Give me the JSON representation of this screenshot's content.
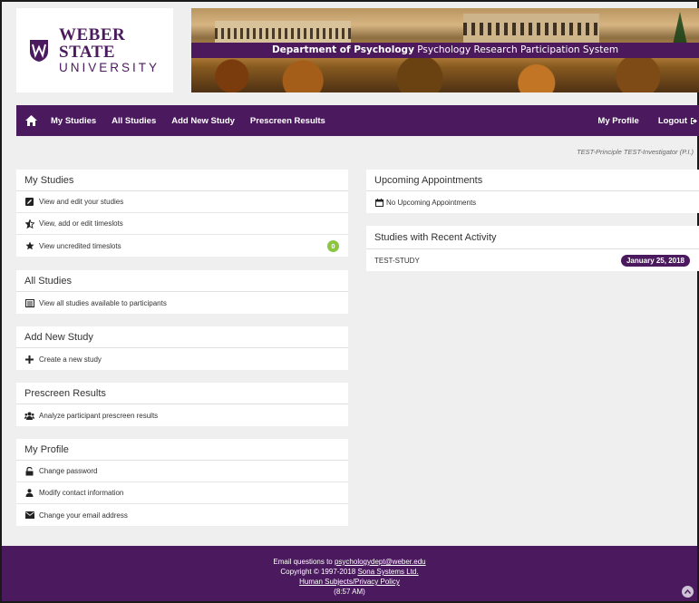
{
  "logo": {
    "line1": "WEBER STATE",
    "line2": "UNIVERSITY"
  },
  "banner": {
    "dept": "Department of Psychology",
    "system": " Psychology Research Participation System"
  },
  "nav": {
    "items": [
      "My Studies",
      "All Studies",
      "Add New Study",
      "Prescreen Results"
    ],
    "profile": "My Profile",
    "logout": "Logout"
  },
  "user_line": "TEST-Principle TEST-Investigator (P.I.)",
  "my_studies": {
    "title": "My Studies",
    "rows": [
      "View and edit your studies",
      "View, add or edit timeslots",
      "View uncredited timeslots"
    ],
    "uncredited_count": "0"
  },
  "all_studies": {
    "title": "All Studies",
    "rows": [
      "View all studies available to participants"
    ]
  },
  "add_study": {
    "title": "Add New Study",
    "rows": [
      "Create a new study"
    ]
  },
  "prescreen": {
    "title": "Prescreen Results",
    "rows": [
      "Analyze participant prescreen results"
    ]
  },
  "profile": {
    "title": "My Profile",
    "rows": [
      "Change password",
      "Modify contact information",
      "Change your email address"
    ]
  },
  "appointments": {
    "title": "Upcoming Appointments",
    "empty": "No Upcoming Appointments"
  },
  "recent": {
    "title": "Studies with Recent Activity",
    "items": [
      {
        "name": "TEST-STUDY",
        "date": "January 25, 2018"
      }
    ]
  },
  "footer": {
    "email_prefix": "Email questions to ",
    "email": "psychologydept@weber.edu",
    "copyright_prefix": "Copyright © 1997-2018 ",
    "company": "Sona Systems Ltd.",
    "policy": "Human Subjects/Privacy Policy",
    "time": "(8:57 AM)"
  },
  "colors": {
    "brand_purple": "#4b1a5e",
    "badge_green": "#8cc63f"
  }
}
